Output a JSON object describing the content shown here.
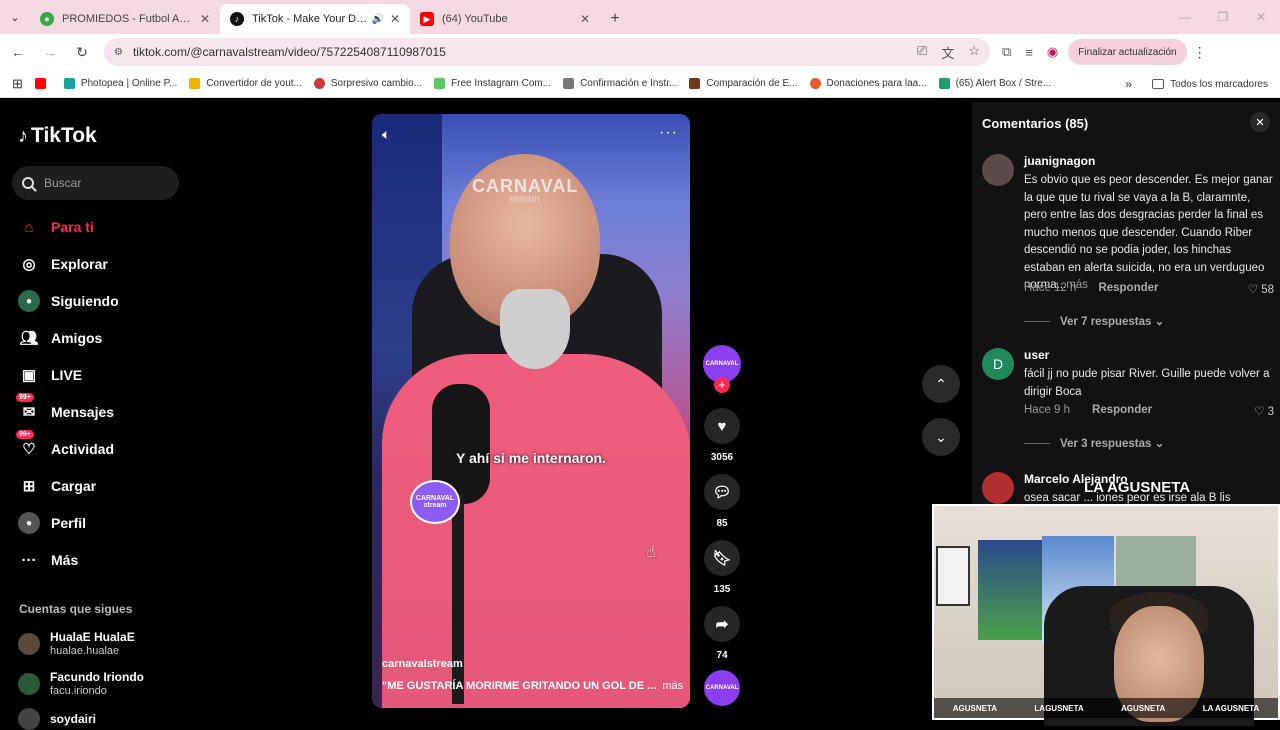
{
  "tabs": [
    {
      "title": "PROMIEDOS - Futbol Argentino",
      "fav_color": "#3aa84a"
    },
    {
      "title": "TikTok - Make Your Day",
      "fav_color": "#111111"
    },
    {
      "title": "(64) YouTube",
      "fav_color": "#ff0000"
    }
  ],
  "address": {
    "url": "tiktok.com/@carnavalstream/video/7572254087110987015",
    "update_label": "Finalizar actualización"
  },
  "bookmarks": [
    {
      "label": "",
      "color": "#ff0000"
    },
    {
      "label": "Photopea | Online P...",
      "color": "#1ba39c"
    },
    {
      "label": "Convertidor de yout...",
      "color": "#f0b400"
    },
    {
      "label": "Sorpresivo cambio...",
      "color": "#d23a3a"
    },
    {
      "label": "Free Instagram Com...",
      "color": "#5ac85a"
    },
    {
      "label": "Confirmación e Instr...",
      "color": "#777777"
    },
    {
      "label": "Comparación de E...",
      "color": "#6a3a1a"
    },
    {
      "label": "Donaciones para laa...",
      "color": "#e85a2a"
    },
    {
      "label": "(65) Alert Box / Stre...",
      "color": "#1aa06a"
    }
  ],
  "bookmarks_all": "Todos los marcadores",
  "tiktok": {
    "logo": "TikTok",
    "search_placeholder": "Buscar",
    "nav": [
      {
        "label": "Para ti",
        "icon": "home-icon"
      },
      {
        "label": "Explorar",
        "icon": "compass-icon"
      },
      {
        "label": "Siguiendo",
        "icon": "following-icon"
      },
      {
        "label": "Amigos",
        "icon": "friends-icon"
      },
      {
        "label": "LIVE",
        "icon": "live-icon"
      },
      {
        "label": "Mensajes",
        "icon": "messages-icon",
        "badge": "99+"
      },
      {
        "label": "Actividad",
        "icon": "activity-icon",
        "badge": "99+"
      },
      {
        "label": "Cargar",
        "icon": "upload-icon"
      },
      {
        "label": "Perfil",
        "icon": "profile-icon"
      },
      {
        "label": "Más",
        "icon": "more-icon"
      }
    ],
    "following_header": "Cuentas que sigues",
    "following": [
      {
        "name": "HualaE HualaE",
        "user": "hualae.hualae"
      },
      {
        "name": "Facundo Iriondo",
        "user": "facu.iriondo"
      },
      {
        "name": "soydairi",
        "user": ""
      }
    ]
  },
  "video": {
    "watermark": "CARNAVAL",
    "watermark_sub": "stream",
    "subtitle": "Y ahí si me internaron.",
    "sticker": "CARNAVAL stream",
    "username": "carnavalstream",
    "description": "\"ME GUSTARÍA MORIRME GRITANDO UN GOL DE ...",
    "more": "más",
    "likes": "3056",
    "comments": "85",
    "saves": "135",
    "shares": "74",
    "creator_label": "CARNAVAL"
  },
  "comments_panel": {
    "title": "Comentarios (85)",
    "items": [
      {
        "user": "juanignagon",
        "text": "Es obvio que es peor descender. Es mejor ganar la que que tu rival se vaya a la B, claramnte, pero entre las dos desgracias perder la final es mucho menos que descender. Cuando Riber descendió no se podia joder, los hinchas estaban en alerta suicida, no era un verdugueo norma...",
        "more": "más",
        "time": "Hace 12 h",
        "reply": "Responder",
        "likes": "58",
        "replies": "Ver 7 respuestas ⌄"
      },
      {
        "user": "user",
        "avatar_letter": "D",
        "text": "fácil jj no pude pisar River. Guille puede volver a dirigir Boca",
        "time": "Hace 9 h",
        "reply": "Responder",
        "likes": "3",
        "replies": "Ver 3 respuestas ⌄"
      },
      {
        "user": "Marcelo Alejandro",
        "text": "osea sacar ... iones peor es irse ala B lis"
      }
    ]
  },
  "webcam": {
    "brand": "LA AGUSNETA",
    "footer": [
      "AGUSNETA",
      "LAGUSNETA",
      "AGUSNETA",
      "LA AGUSNETA"
    ]
  }
}
